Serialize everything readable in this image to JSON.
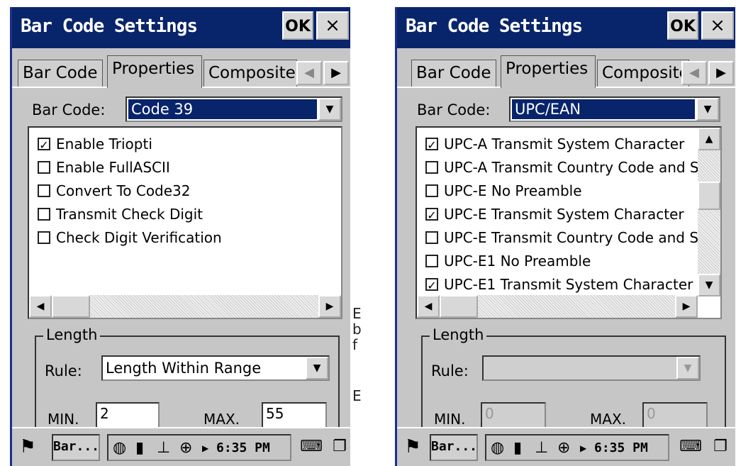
{
  "left": {
    "title": "Bar Code Settings",
    "ok_label": "OK",
    "close_label": "×",
    "tabs": [
      "Bar Code",
      "Properties",
      "Composite"
    ],
    "barcode_label": "Bar Code:",
    "barcode_value": "Code 39",
    "options": [
      {
        "label": "Enable Triopti",
        "checked": true
      },
      {
        "label": "Enable FullASCII",
        "checked": false
      },
      {
        "label": "Convert To Code32",
        "checked": false
      },
      {
        "label": "Transmit Check Digit",
        "checked": false
      },
      {
        "label": "Check Digit Verification",
        "checked": false
      }
    ],
    "length_legend": "Length",
    "rule_label": "Rule:",
    "rule_value": "Length Within Range",
    "min_label": "MIN.",
    "min_value": "2",
    "max_label": "MAX.",
    "max_value": "55",
    "taskbar_app": "Bar...",
    "time": "6:35 PM"
  },
  "right": {
    "title": "Bar Code Settings",
    "ok_label": "OK",
    "close_label": "×",
    "tabs": [
      "Bar Code",
      "Properties",
      "Composite"
    ],
    "barcode_label": "Bar Code:",
    "barcode_value": "UPC/EAN",
    "options": [
      {
        "label": "UPC-A Transmit System Character",
        "checked": true
      },
      {
        "label": "UPC-A Transmit Country Code and S",
        "checked": false
      },
      {
        "label": "UPC-E No Preamble",
        "checked": false
      },
      {
        "label": "UPC-E Transmit System Character",
        "checked": true
      },
      {
        "label": "UPC-E Transmit Country Code and S",
        "checked": false
      },
      {
        "label": "UPC-E1 No Preamble",
        "checked": false
      },
      {
        "label": "UPC-E1 Transmit System Character",
        "checked": true
      }
    ],
    "length_legend": "Length",
    "rule_label": "Rule:",
    "rule_value": "",
    "min_label": "MIN.",
    "min_value": "0",
    "max_label": "MAX.",
    "max_value": "0",
    "taskbar_app": "Bar...",
    "time": "6:35 PM"
  },
  "background_fragments": [
    "E",
    "b",
    "f",
    "E"
  ],
  "icons": {
    "start": "windows-flag-icon",
    "globe": "network-globe-icon",
    "signal": "signal-bars-icon",
    "sync": "activesync-icon",
    "battery": "battery-icon",
    "keyboard": "keyboard-icon",
    "switch": "window-switch-icon"
  },
  "colors": {
    "titlebar": "#08246b",
    "dialog": "#c6c6c6",
    "selection": "#08246b"
  }
}
